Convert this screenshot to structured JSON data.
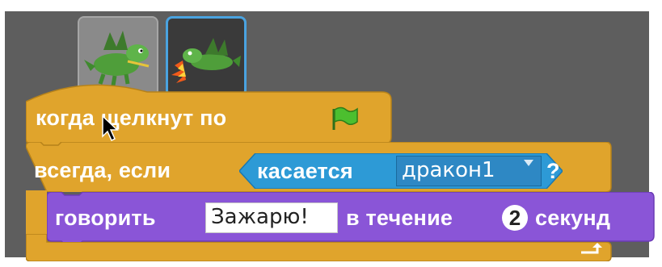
{
  "sprites": {
    "costume1_icon": "dragon-icon",
    "costume2_icon": "dragon-breathing-fire-icon"
  },
  "blocks": {
    "hat": {
      "text": "когда щелкнут по",
      "icon": "green-flag-icon"
    },
    "forever_if": {
      "text": "всегда, если"
    },
    "touching": {
      "text": "касается",
      "target": "дракон1",
      "suffix": "?"
    },
    "say": {
      "verb": "говорить",
      "message": "Зажарю!",
      "for_text": "в течение",
      "seconds": "2",
      "unit": "секунд"
    }
  },
  "colors": {
    "control": "#e0a42c",
    "sensing": "#2d9ad6",
    "looks": "#8a55d7",
    "stage_bg": "#5e5e5e"
  }
}
